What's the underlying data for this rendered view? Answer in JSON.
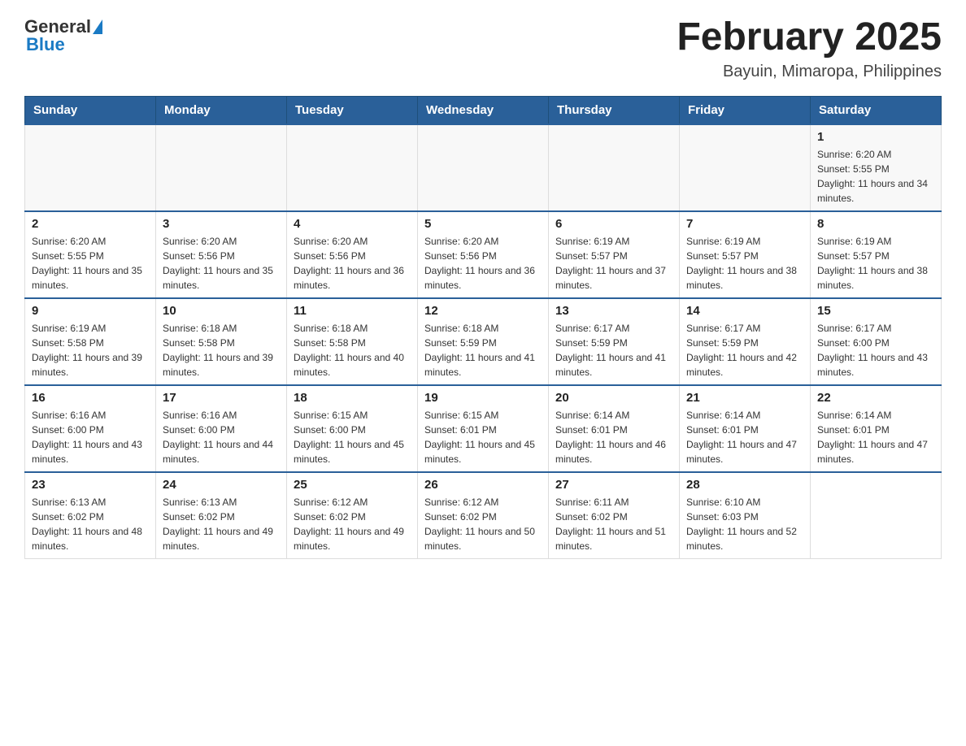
{
  "header": {
    "logo_general": "General",
    "logo_blue": "Blue",
    "title": "February 2025",
    "subtitle": "Bayuin, Mimaropa, Philippines"
  },
  "days_of_week": [
    "Sunday",
    "Monday",
    "Tuesday",
    "Wednesday",
    "Thursday",
    "Friday",
    "Saturday"
  ],
  "weeks": [
    [
      {
        "day": "",
        "sunrise": "",
        "sunset": "",
        "daylight": ""
      },
      {
        "day": "",
        "sunrise": "",
        "sunset": "",
        "daylight": ""
      },
      {
        "day": "",
        "sunrise": "",
        "sunset": "",
        "daylight": ""
      },
      {
        "day": "",
        "sunrise": "",
        "sunset": "",
        "daylight": ""
      },
      {
        "day": "",
        "sunrise": "",
        "sunset": "",
        "daylight": ""
      },
      {
        "day": "",
        "sunrise": "",
        "sunset": "",
        "daylight": ""
      },
      {
        "day": "1",
        "sunrise": "Sunrise: 6:20 AM",
        "sunset": "Sunset: 5:55 PM",
        "daylight": "Daylight: 11 hours and 34 minutes."
      }
    ],
    [
      {
        "day": "2",
        "sunrise": "Sunrise: 6:20 AM",
        "sunset": "Sunset: 5:55 PM",
        "daylight": "Daylight: 11 hours and 35 minutes."
      },
      {
        "day": "3",
        "sunrise": "Sunrise: 6:20 AM",
        "sunset": "Sunset: 5:56 PM",
        "daylight": "Daylight: 11 hours and 35 minutes."
      },
      {
        "day": "4",
        "sunrise": "Sunrise: 6:20 AM",
        "sunset": "Sunset: 5:56 PM",
        "daylight": "Daylight: 11 hours and 36 minutes."
      },
      {
        "day": "5",
        "sunrise": "Sunrise: 6:20 AM",
        "sunset": "Sunset: 5:56 PM",
        "daylight": "Daylight: 11 hours and 36 minutes."
      },
      {
        "day": "6",
        "sunrise": "Sunrise: 6:19 AM",
        "sunset": "Sunset: 5:57 PM",
        "daylight": "Daylight: 11 hours and 37 minutes."
      },
      {
        "day": "7",
        "sunrise": "Sunrise: 6:19 AM",
        "sunset": "Sunset: 5:57 PM",
        "daylight": "Daylight: 11 hours and 38 minutes."
      },
      {
        "day": "8",
        "sunrise": "Sunrise: 6:19 AM",
        "sunset": "Sunset: 5:57 PM",
        "daylight": "Daylight: 11 hours and 38 minutes."
      }
    ],
    [
      {
        "day": "9",
        "sunrise": "Sunrise: 6:19 AM",
        "sunset": "Sunset: 5:58 PM",
        "daylight": "Daylight: 11 hours and 39 minutes."
      },
      {
        "day": "10",
        "sunrise": "Sunrise: 6:18 AM",
        "sunset": "Sunset: 5:58 PM",
        "daylight": "Daylight: 11 hours and 39 minutes."
      },
      {
        "day": "11",
        "sunrise": "Sunrise: 6:18 AM",
        "sunset": "Sunset: 5:58 PM",
        "daylight": "Daylight: 11 hours and 40 minutes."
      },
      {
        "day": "12",
        "sunrise": "Sunrise: 6:18 AM",
        "sunset": "Sunset: 5:59 PM",
        "daylight": "Daylight: 11 hours and 41 minutes."
      },
      {
        "day": "13",
        "sunrise": "Sunrise: 6:17 AM",
        "sunset": "Sunset: 5:59 PM",
        "daylight": "Daylight: 11 hours and 41 minutes."
      },
      {
        "day": "14",
        "sunrise": "Sunrise: 6:17 AM",
        "sunset": "Sunset: 5:59 PM",
        "daylight": "Daylight: 11 hours and 42 minutes."
      },
      {
        "day": "15",
        "sunrise": "Sunrise: 6:17 AM",
        "sunset": "Sunset: 6:00 PM",
        "daylight": "Daylight: 11 hours and 43 minutes."
      }
    ],
    [
      {
        "day": "16",
        "sunrise": "Sunrise: 6:16 AM",
        "sunset": "Sunset: 6:00 PM",
        "daylight": "Daylight: 11 hours and 43 minutes."
      },
      {
        "day": "17",
        "sunrise": "Sunrise: 6:16 AM",
        "sunset": "Sunset: 6:00 PM",
        "daylight": "Daylight: 11 hours and 44 minutes."
      },
      {
        "day": "18",
        "sunrise": "Sunrise: 6:15 AM",
        "sunset": "Sunset: 6:00 PM",
        "daylight": "Daylight: 11 hours and 45 minutes."
      },
      {
        "day": "19",
        "sunrise": "Sunrise: 6:15 AM",
        "sunset": "Sunset: 6:01 PM",
        "daylight": "Daylight: 11 hours and 45 minutes."
      },
      {
        "day": "20",
        "sunrise": "Sunrise: 6:14 AM",
        "sunset": "Sunset: 6:01 PM",
        "daylight": "Daylight: 11 hours and 46 minutes."
      },
      {
        "day": "21",
        "sunrise": "Sunrise: 6:14 AM",
        "sunset": "Sunset: 6:01 PM",
        "daylight": "Daylight: 11 hours and 47 minutes."
      },
      {
        "day": "22",
        "sunrise": "Sunrise: 6:14 AM",
        "sunset": "Sunset: 6:01 PM",
        "daylight": "Daylight: 11 hours and 47 minutes."
      }
    ],
    [
      {
        "day": "23",
        "sunrise": "Sunrise: 6:13 AM",
        "sunset": "Sunset: 6:02 PM",
        "daylight": "Daylight: 11 hours and 48 minutes."
      },
      {
        "day": "24",
        "sunrise": "Sunrise: 6:13 AM",
        "sunset": "Sunset: 6:02 PM",
        "daylight": "Daylight: 11 hours and 49 minutes."
      },
      {
        "day": "25",
        "sunrise": "Sunrise: 6:12 AM",
        "sunset": "Sunset: 6:02 PM",
        "daylight": "Daylight: 11 hours and 49 minutes."
      },
      {
        "day": "26",
        "sunrise": "Sunrise: 6:12 AM",
        "sunset": "Sunset: 6:02 PM",
        "daylight": "Daylight: 11 hours and 50 minutes."
      },
      {
        "day": "27",
        "sunrise": "Sunrise: 6:11 AM",
        "sunset": "Sunset: 6:02 PM",
        "daylight": "Daylight: 11 hours and 51 minutes."
      },
      {
        "day": "28",
        "sunrise": "Sunrise: 6:10 AM",
        "sunset": "Sunset: 6:03 PM",
        "daylight": "Daylight: 11 hours and 52 minutes."
      },
      {
        "day": "",
        "sunrise": "",
        "sunset": "",
        "daylight": ""
      }
    ]
  ]
}
